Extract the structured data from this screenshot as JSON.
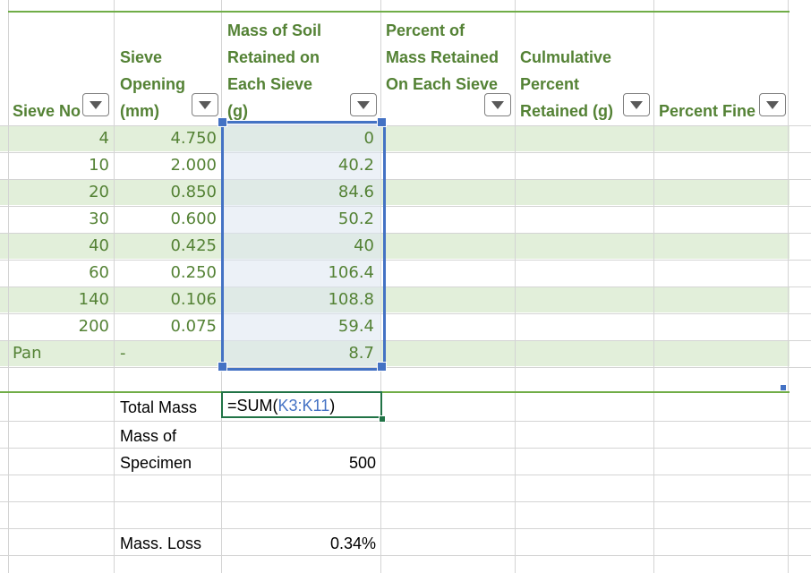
{
  "headers": {
    "col_a": "Sieve No",
    "col_b_line1": "Sieve",
    "col_b_line2": "Opening",
    "col_b_line3": "(mm)",
    "col_c_line1": "Mass of Soil",
    "col_c_line2": "Retained on",
    "col_c_line3": "Each Sieve",
    "col_c_line4": "(g)",
    "col_d_line1": "Percent of",
    "col_d_line2": "Mass Retained",
    "col_d_line3": "On Each Sieve",
    "col_e_line1": "Culmulative",
    "col_e_line2": "Percent",
    "col_e_line3": "Retained (g)",
    "col_f": "Percent Fine"
  },
  "rows": [
    {
      "sieve": "4",
      "opening": "4.750",
      "mass": "0"
    },
    {
      "sieve": "10",
      "opening": "2.000",
      "mass": "40.2"
    },
    {
      "sieve": "20",
      "opening": "0.850",
      "mass": "84.6"
    },
    {
      "sieve": "30",
      "opening": "0.600",
      "mass": "50.2"
    },
    {
      "sieve": "40",
      "opening": "0.425",
      "mass": "40"
    },
    {
      "sieve": "60",
      "opening": "0.250",
      "mass": "106.4"
    },
    {
      "sieve": "140",
      "opening": "0.106",
      "mass": "108.8"
    },
    {
      "sieve": "200",
      "opening": "0.075",
      "mass": "59.4"
    },
    {
      "sieve": "Pan",
      "opening": "-",
      "mass": "8.7"
    }
  ],
  "summary": {
    "total_mass_label": "Total Mass",
    "formula_prefix": "=SUM(",
    "formula_ref": "K3:K11",
    "formula_suffix": ")",
    "specimen_label_line1": "Mass of",
    "specimen_label_line2": "Specimen",
    "specimen_value": "500",
    "mass_loss_label": "Mass. Loss",
    "mass_loss_value": "0.34%"
  },
  "colors": {
    "header_text": "#548235",
    "band": "#e2efda",
    "selection": "#4472c4",
    "active_cell_border": "#217346"
  }
}
